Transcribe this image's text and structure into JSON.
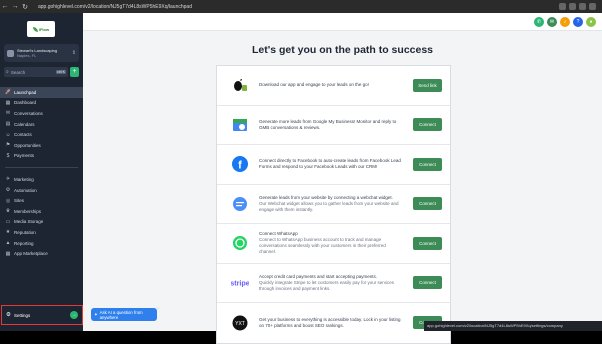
{
  "browser": {
    "url": "app.gohighlevel.com/v2/location/NJ5gT7d4L8sWP5hE9Xq/launchpad",
    "status_url": "app.gohighlevel.com/v2/location/NJ5gT7d4L8sWP5hE9Xq/settings/company"
  },
  "sidebar": {
    "logo_text": "iFlow",
    "account": {
      "name": "Stewart's Landscaping",
      "location": "Naples, FL"
    },
    "search": {
      "placeholder": "Search",
      "shortcut": "ctrl K"
    },
    "items": [
      {
        "label": "Launchpad",
        "icon": "rocket-icon",
        "glyph": "🚀",
        "active": true
      },
      {
        "label": "Dashboard",
        "icon": "dashboard-icon",
        "glyph": "▦"
      },
      {
        "label": "Conversations",
        "icon": "chat-icon",
        "glyph": "✉"
      },
      {
        "label": "Calendars",
        "icon": "calendar-icon",
        "glyph": "▤"
      },
      {
        "label": "Contacts",
        "icon": "contacts-icon",
        "glyph": "☺"
      },
      {
        "label": "Opportunities",
        "icon": "funnel-icon",
        "glyph": "⚑"
      },
      {
        "label": "Payments",
        "icon": "payments-icon",
        "glyph": "$"
      }
    ],
    "items2": [
      {
        "label": "Marketing",
        "icon": "megaphone-icon",
        "glyph": "✈"
      },
      {
        "label": "Automation",
        "icon": "automation-icon",
        "glyph": "⚙"
      },
      {
        "label": "Sites",
        "icon": "globe-icon",
        "glyph": "◎"
      },
      {
        "label": "Memberships",
        "icon": "membership-icon",
        "glyph": "♛"
      },
      {
        "label": "Media Storage",
        "icon": "folder-icon",
        "glyph": "▭"
      },
      {
        "label": "Reputation",
        "icon": "star-icon",
        "glyph": "★"
      },
      {
        "label": "Reporting",
        "icon": "chart-icon",
        "glyph": "▲"
      },
      {
        "label": "App Marketplace",
        "icon": "grid-icon",
        "glyph": "▦"
      }
    ],
    "settings": {
      "label": "Settings",
      "badge": "→"
    }
  },
  "main": {
    "heading": "Let's get you on the path to success",
    "cards": [
      {
        "icon": "mobile-app-icon",
        "text": "Download our app and engage to your leads on the go!",
        "muted": "",
        "button": "Send link"
      },
      {
        "icon": "google-business-icon",
        "text": "Generate more leads from Google My Business! Monitor and reply to GMB conversations & reviews.",
        "muted": "",
        "button": "Connect"
      },
      {
        "icon": "facebook-icon",
        "text": "Connect directly to Facebook to auto-create leads from Facebook Lead Forms and respond to your Facebook Leads with our CRM!",
        "muted": "",
        "button": "Connect"
      },
      {
        "icon": "webchat-icon",
        "text": "Generate leads from your website by connecting a webchat widget.",
        "muted": "Our Webchat widget allows you to gather leads from your website and engage with them instantly.",
        "button": "Connect"
      },
      {
        "icon": "whatsapp-icon",
        "text": "Connect WhatsApp",
        "muted": "Connect to WhatsApp business account to track and manage conversations seamlessly with your customers in their preferred channel.",
        "button": "Connect"
      },
      {
        "icon": "stripe-icon",
        "text": "Accept credit card payments and start accepting payments.",
        "muted": "Quickly integrate Stripe to let customers easily pay for your services through invoices and payment links.",
        "button": "Connect"
      },
      {
        "icon": "yext-icon",
        "text": "Get your business to everything is accessible today. Lock in your listing on 70+ platforms and boost SEO rankings.",
        "muted": "",
        "button": "Connect"
      }
    ]
  },
  "ai_widget": {
    "label": "Ask AI a question from anywhere",
    "close": "✕"
  },
  "colors": {
    "sidebar_bg": "#1d2533",
    "button_green": "#3d8b57",
    "accent_green": "#2bb673",
    "settings_outline": "#e53935"
  }
}
